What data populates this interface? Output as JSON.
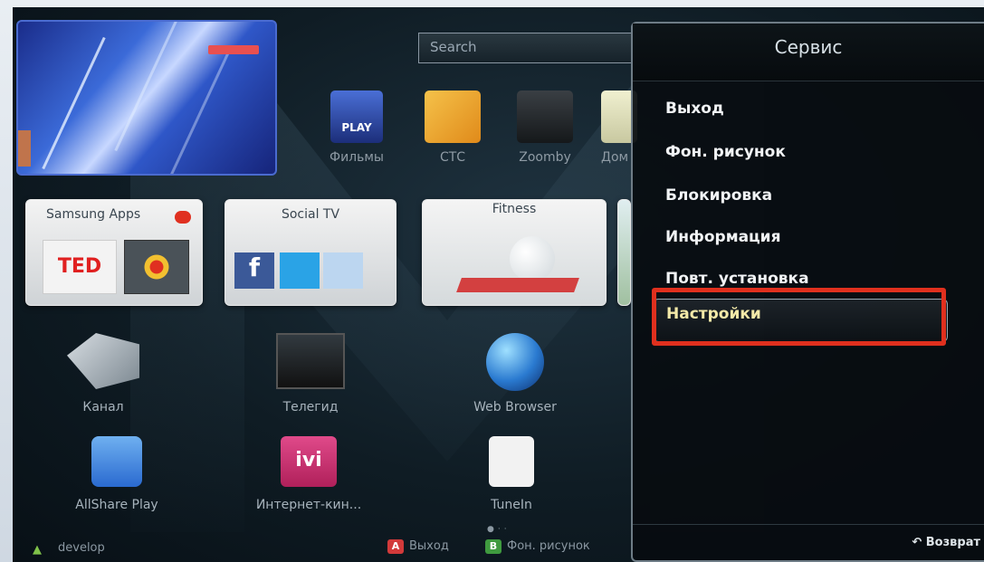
{
  "search": {
    "placeholder": "Search"
  },
  "apps_row": [
    {
      "label": "Фильмы",
      "badge": "PLAY"
    },
    {
      "label": "СТС"
    },
    {
      "label": "Zoomby"
    },
    {
      "label": "Дом"
    }
  ],
  "tiles": {
    "samsung_apps": {
      "title": "Samsung Apps",
      "sub": "TED"
    },
    "social_tv": {
      "title": "Social TV"
    },
    "fitness": {
      "title": "Fitness"
    }
  },
  "icons_row1": [
    {
      "label": "Канал"
    },
    {
      "label": "Телегид"
    },
    {
      "label": "Web Browser"
    }
  ],
  "icons_row2": [
    {
      "label": "AllShare Play"
    },
    {
      "label": "Интернет-кин..."
    },
    {
      "label": "TuneIn"
    }
  ],
  "menu": {
    "title": "Сервис",
    "items": [
      "Выход",
      "Фон. рисунок",
      "Блокировка",
      "Информация",
      "Повт. установка",
      "Настройки"
    ],
    "back": "Возврат"
  },
  "bottom_bar": {
    "user": "develop",
    "keys": [
      {
        "key": "A",
        "label": "Выход",
        "color": "#d23a3a"
      },
      {
        "key": "B",
        "label": "Фон. рисунок",
        "color": "#3f9a3f"
      }
    ]
  },
  "colors": {
    "highlight": "#e0301e",
    "selected_text": "#f3e9a8"
  }
}
